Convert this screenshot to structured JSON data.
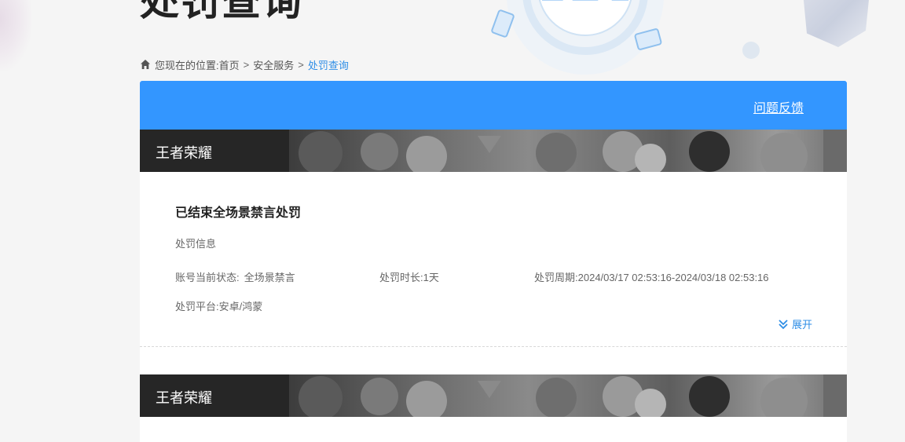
{
  "page": {
    "title": "处罚查询"
  },
  "breadcrumb": {
    "prefix": "您现在的位置:",
    "items": [
      "首页",
      "安全服务",
      "处罚查询"
    ],
    "separator": ">"
  },
  "header": {
    "feedback_label": "问题反馈"
  },
  "records": [
    {
      "game": "王者荣耀",
      "title": "已结束全场景禁言处罚",
      "section_label": "处罚信息",
      "status_label": "账号当前状态:",
      "status_value": "全场景禁言",
      "duration_label": "处罚时长:",
      "duration_value": "1天",
      "period_label": "处罚周期:",
      "period_value": "2024/03/17 02:53:16-2024/03/18 02:53:16",
      "platform_label": "处罚平台:",
      "platform_value": "安卓/鸿蒙",
      "expand_label": "展开"
    },
    {
      "game": "王者荣耀"
    }
  ],
  "colors": {
    "accent": "#3396ff",
    "link": "#2f8ee6",
    "background": "#f5f5f5"
  },
  "icons": {
    "home": "home-icon",
    "expand": "double-chevron-down-icon"
  }
}
